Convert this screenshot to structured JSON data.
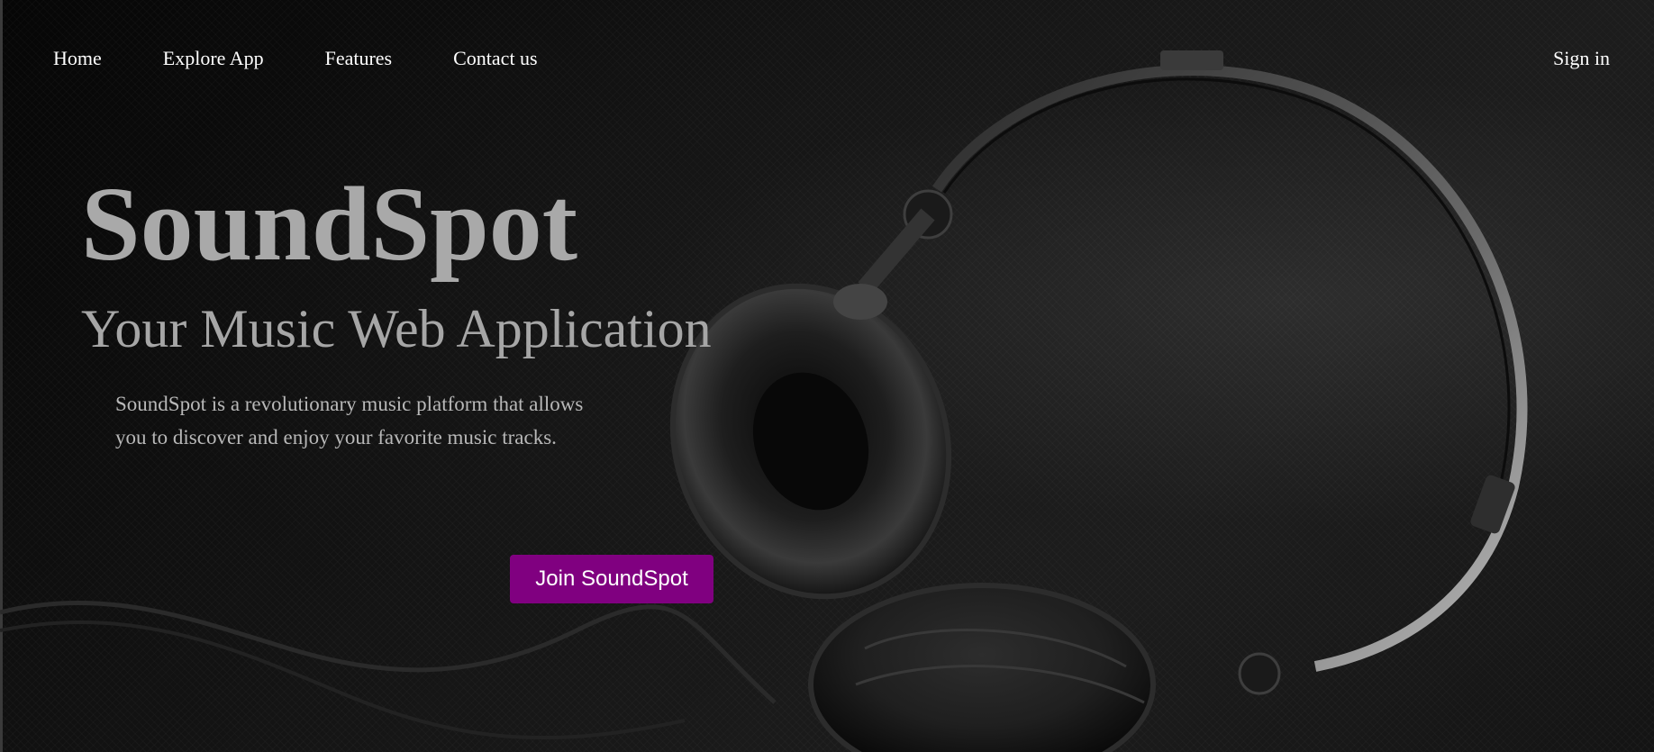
{
  "nav": {
    "items": [
      {
        "label": "Home"
      },
      {
        "label": "Explore App"
      },
      {
        "label": "Features"
      },
      {
        "label": "Contact us"
      }
    ],
    "signin_label": "Sign in"
  },
  "hero": {
    "title": "SoundSpot",
    "subtitle": "Your Music Web Application",
    "description": "SoundSpot is a revolutionary music platform that allows you to discover and enjoy your favorite music tracks.",
    "cta_label": "Join SoundSpot",
    "background_image": "headphones-photo"
  },
  "colors": {
    "cta_background": "#800080",
    "title_text": "#a9a9a9",
    "nav_text": "#ffffff",
    "background": "#111111"
  }
}
